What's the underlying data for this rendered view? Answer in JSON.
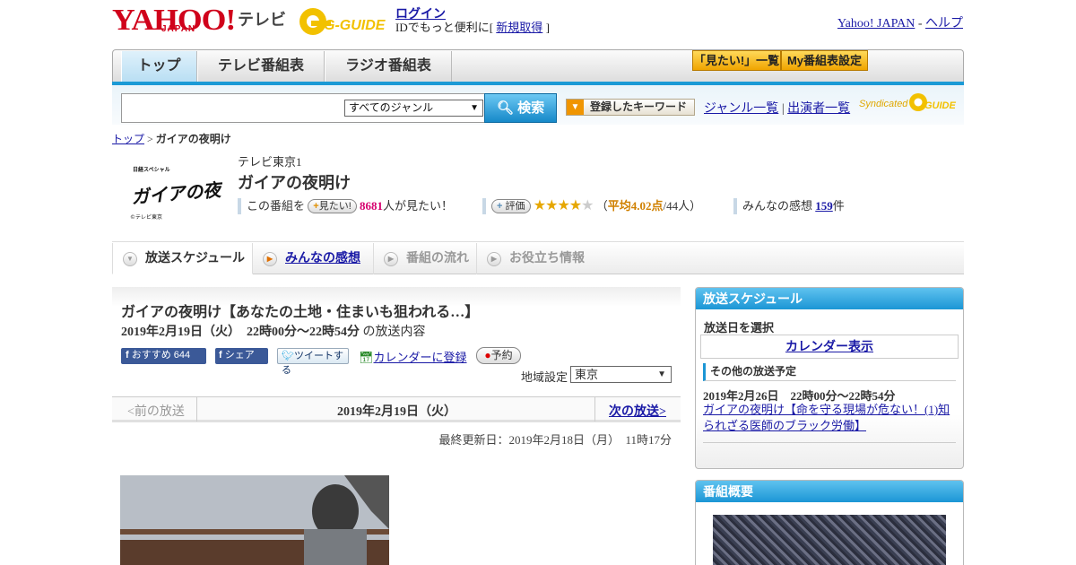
{
  "header": {
    "brand": "YAHOO!",
    "brand_sub": "JAPAN",
    "service": "テレビ",
    "partner": "G-GUIDE",
    "login_label": "ログイン",
    "login_text_prefix": "IDでもっと便利に[ ",
    "signup_label": "新規取得",
    "login_text_suffix": " ]",
    "links": [
      "Yahoo! JAPAN",
      "ヘルプ"
    ]
  },
  "nav": {
    "tabs": [
      "トップ",
      "テレビ番組表",
      "ラジオ番組表"
    ],
    "mitai_button": "「見たい!」一覧",
    "myprog_button": "My番組表設定"
  },
  "search": {
    "input_value": "",
    "genre_selected": "すべてのジャンル",
    "button_label": "検索",
    "keyword_button": "登録したキーワード",
    "genre_list_link": "ジャンル一覧",
    "cast_list_link": "出演者一覧",
    "syndicated": "Syndicated"
  },
  "breadcrumb": {
    "top": "トップ",
    "separator": " > ",
    "current": "ガイアの夜明け"
  },
  "program": {
    "logo_text": "ガイアの夜明け",
    "logo_caption": "©テレビ東京",
    "logo_series": "日経スペシャル",
    "channel": "テレビ東京1",
    "title": "ガイアの夜明け",
    "want_prefix": "この番組を",
    "want_button": "見たい!",
    "want_count": "8681",
    "want_suffix": "人が見たい！",
    "rate_button": "評価",
    "rating_stars": 4,
    "rating_open": "（",
    "rating_avg": "平均4.02点",
    "rating_count": "/44人）",
    "reviews_prefix": "みんなの感想",
    "reviews_count": "159",
    "reviews_suffix": "件"
  },
  "tabs": [
    "放送スケジュール",
    "みんなの感想",
    "番組の流れ",
    "お役立ち情報"
  ],
  "episode": {
    "title": "ガイアの夜明け【あなたの土地・住まいも狙われる…】",
    "date_time": "2019年2月19日（火）　22時00分～22時54分",
    "date_suffix": "の放送内容",
    "fb_recommend": "おすすめ",
    "fb_count": "644",
    "fb_share": "シェア",
    "tweet": "ツイートする",
    "calendar_register": "カレンダーに登録",
    "reserve": "予約",
    "region_label": "地域設定",
    "region_value": "東京",
    "prev": "<前の放送",
    "date": "2019年2月19日（火）",
    "next": "次の放送>",
    "updated": "最終更新日：2019年2月18日（月）　11時17分"
  },
  "sidebar": {
    "schedule_head": "放送スケジュール",
    "date_select_label": "放送日を選択",
    "calendar_link": "カレンダー表示",
    "other_head": "その他の放送予定",
    "other_time": "2019年2月26日　22時00分～22時54分",
    "other_title": "ガイアの夜明け【命を守る現場が危ない！(1)知られざる医師のブラック労働】",
    "summary_head": "番組概要"
  },
  "colors": {
    "accent_blue": "#1b96d5",
    "brand_red": "#d0021b",
    "link": "#1a1aa6",
    "star": "#e6a700"
  }
}
